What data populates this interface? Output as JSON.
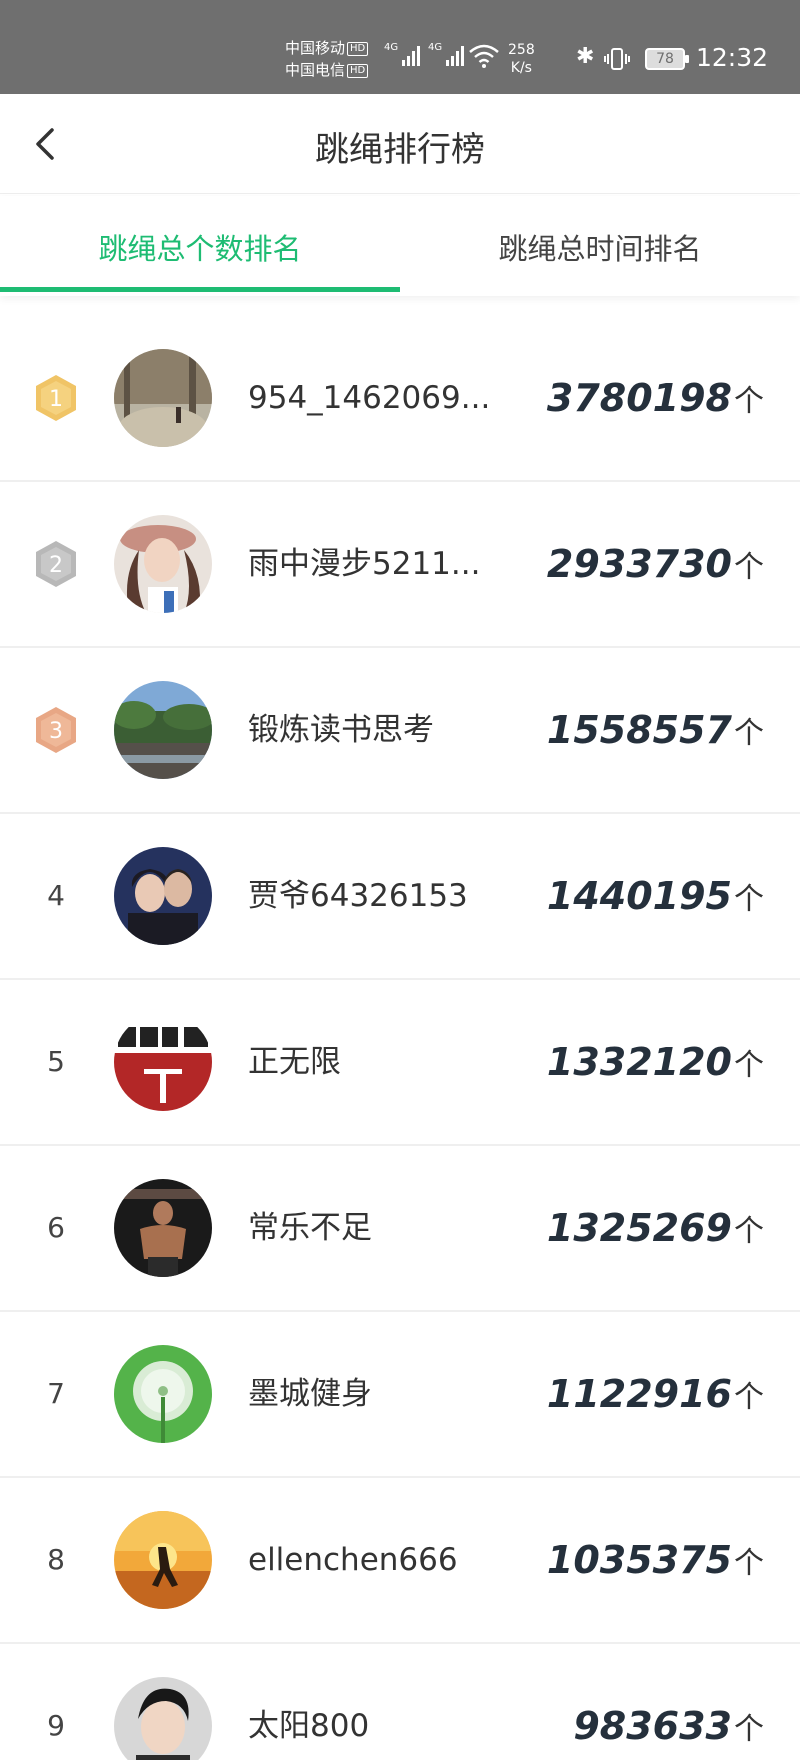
{
  "status_bar": {
    "carrier1": "中国移动",
    "carrier2": "中国电信",
    "hd": "HD",
    "net1": "4G",
    "net2": "4G",
    "speed_value": "258",
    "speed_unit": "K/s",
    "battery": "78",
    "time": "12:32"
  },
  "nav": {
    "title": "跳绳排行榜"
  },
  "tabs": [
    {
      "label": "跳绳总个数排名",
      "active": true
    },
    {
      "label": "跳绳总时间排名",
      "active": false
    }
  ],
  "colors": {
    "accent": "#1ebc73",
    "gold": "#f0c466",
    "silver": "#b8b8b8",
    "bronze": "#e8a785",
    "score": "#25303c"
  },
  "unit": "个",
  "ranking": [
    {
      "rank": "1",
      "medal": "gold",
      "name": "954_1462069...",
      "score": "3780198",
      "avatar": "forest-path-photo"
    },
    {
      "rank": "2",
      "medal": "silver",
      "name": "雨中漫步5211...",
      "score": "2933730",
      "avatar": "woman-hat-photo"
    },
    {
      "rank": "3",
      "medal": "bronze",
      "name": "锻炼读书思考",
      "score": "1558557",
      "avatar": "lake-landscape-photo"
    },
    {
      "rank": "4",
      "medal": "",
      "name": "贾爷64326153",
      "score": "1440195",
      "avatar": "couple-photo"
    },
    {
      "rank": "5",
      "medal": "",
      "name": "正无限",
      "score": "1332120",
      "avatar": "text-poster-image"
    },
    {
      "rank": "6",
      "medal": "",
      "name": "常乐不足",
      "score": "1325269",
      "avatar": "muscle-man-photo"
    },
    {
      "rank": "7",
      "medal": "",
      "name": "墨城健身",
      "score": "1122916",
      "avatar": "dandelion-photo"
    },
    {
      "rank": "8",
      "medal": "",
      "name": "ellenchen666",
      "score": "1035375",
      "avatar": "sunset-yoga-photo"
    },
    {
      "rank": "9",
      "medal": "",
      "name": "太阳800",
      "score": "983633",
      "avatar": "man-portrait-photo"
    }
  ]
}
